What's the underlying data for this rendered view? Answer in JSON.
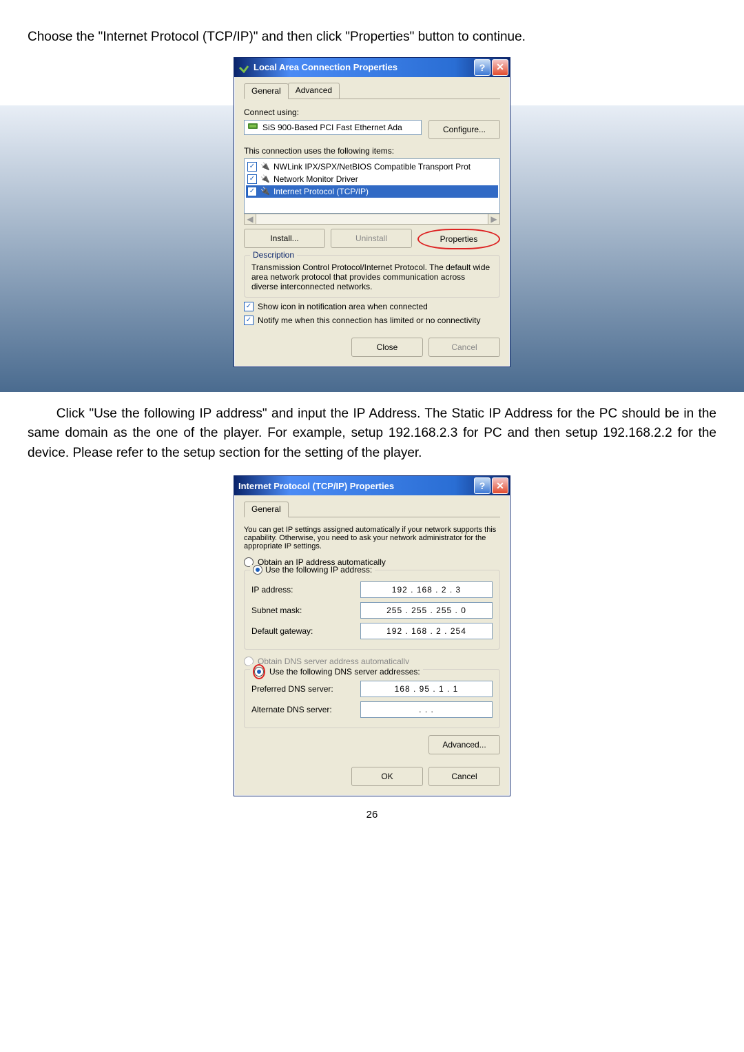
{
  "page": {
    "intro_text": "Choose the \"Internet Protocol (TCP/IP)\" and then click \"Properties\" button to continue.",
    "mid_text": "Click \"Use the following IP address\" and input the IP Address. The Static IP Address for the PC should be in the same domain as the one of the player. For example, setup 192.168.2.3 for PC and then setup 192.168.2.2 for the device. Please refer to the setup section for the setting of the player.",
    "number": "26"
  },
  "dialog1": {
    "title": "Local Area Connection Properties",
    "tabs": {
      "general": "General",
      "advanced": "Advanced"
    },
    "connect_using_label": "Connect using:",
    "adapter": "SiS 900-Based PCI Fast Ethernet Ada",
    "configure_btn": "Configure...",
    "items_label": "This connection uses the following items:",
    "items": [
      "NWLink IPX/SPX/NetBIOS Compatible Transport Prot",
      "Network Monitor Driver",
      "Internet Protocol (TCP/IP)"
    ],
    "install_btn": "Install...",
    "uninstall_btn": "Uninstall",
    "properties_btn": "Properties",
    "desc_legend": "Description",
    "desc_text": "Transmission Control Protocol/Internet Protocol. The default wide area network protocol that provides communication across diverse interconnected networks.",
    "cb1": "Show icon in notification area when connected",
    "cb2": "Notify me when this connection has limited or no connectivity",
    "close_btn": "Close",
    "cancel_btn": "Cancel"
  },
  "dialog2": {
    "title": "Internet Protocol (TCP/IP) Properties",
    "tab_general": "General",
    "intro": "You can get IP settings assigned automatically if your network supports this capability. Otherwise, you need to ask your network administrator for the appropriate IP settings.",
    "radio_auto_ip": "Obtain an IP address automatically",
    "radio_manual_ip": "Use the following IP address:",
    "labels": {
      "ip": "IP address:",
      "subnet": "Subnet mask:",
      "gateway": "Default gateway:",
      "pref_dns": "Preferred DNS server:",
      "alt_dns": "Alternate DNS server:"
    },
    "values": {
      "ip": "192 . 168 .  2  .  3",
      "subnet": "255 . 255 . 255 .  0",
      "gateway": "192 . 168 .  2  . 254",
      "pref_dns": "168 .  95 .  1  .  1",
      "alt_dns": ".        .        ."
    },
    "radio_auto_dns": "Obtain DNS server address automatically",
    "radio_manual_dns": "Use the following DNS server addresses:",
    "advanced_btn": "Advanced...",
    "ok_btn": "OK",
    "cancel_btn": "Cancel"
  }
}
